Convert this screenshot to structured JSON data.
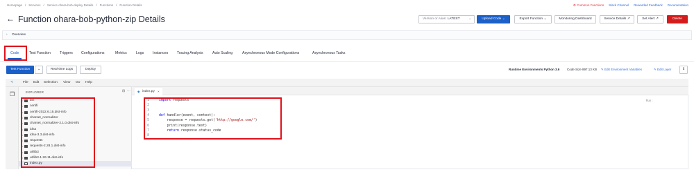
{
  "breadcrumb": [
    "Homepage",
    "/",
    "Services",
    "/",
    "Service ohara-bob-deploy Details",
    "/",
    "Functions",
    "/",
    "Function Details"
  ],
  "top_links": [
    "Common Functions",
    "Slack Channel",
    "Rewarded Feedback",
    "Documentation"
  ],
  "title": "Function ohara-bob-python-zip Details",
  "header_buttons": {
    "version_label": "Version or Alias:",
    "version_value": "LATEST",
    "upload": "Upload Code",
    "export": "Export Function",
    "monitoring": "Monitoring Dashboard",
    "service_details": "Service Details",
    "set_alert": "Set Alert",
    "delete": "Delete"
  },
  "overview_label": "Overview",
  "tabs": [
    "Code",
    "Test Function",
    "Triggers",
    "Configurations",
    "Metrics",
    "Logs",
    "Instances",
    "Tracing Analysis",
    "Auto Scaling",
    "Asynchronous Mode Configurations",
    "Asynchronous Tasks"
  ],
  "toolbar": {
    "test_function": "Test Function",
    "realtime_logs": "Real-time Logs",
    "deploy": "Deploy"
  },
  "runtime_info": {
    "runtime": "Runtime Environments Python 3.6",
    "code_size": "Code Size 897.13 KB",
    "edit_env": "Edit Environment Variables",
    "edit_layer": "Edit Layer"
  },
  "ide_menu": [
    "File",
    "Edit",
    "Selection",
    "View",
    "Go",
    "Help"
  ],
  "explorer": {
    "header": "EXPLORER",
    "items": [
      {
        "name": "bin",
        "type": "folder"
      },
      {
        "name": "certifi",
        "type": "folder"
      },
      {
        "name": "certifi-2022.6.15.dist-info",
        "type": "folder"
      },
      {
        "name": "charset_normalizer",
        "type": "folder"
      },
      {
        "name": "charset_normalizer-2.1.0.dist-info",
        "type": "folder"
      },
      {
        "name": "idna",
        "type": "folder"
      },
      {
        "name": "idna-3.3.dist-info",
        "type": "folder"
      },
      {
        "name": "requests",
        "type": "folder"
      },
      {
        "name": "requests-2.28.1.dist-info",
        "type": "folder"
      },
      {
        "name": "urllib3",
        "type": "folder"
      },
      {
        "name": "urllib3-1.26.11.dist-info",
        "type": "folder"
      },
      {
        "name": "index.py",
        "type": "file"
      }
    ]
  },
  "editor": {
    "tab_name": "index.py",
    "minimap_hint": "Run:",
    "lines": [
      "import requests",
      "",
      "",
      "def handler(event, context):",
      "    response = requests.get('http://google.com/')",
      "    print(response.text)",
      "    return response.status_code",
      ""
    ]
  },
  "colors": {
    "primary": "#1b5fc8",
    "danger": "#d51c1c",
    "highlight": "#e0101a",
    "link": "#2f6bd8"
  }
}
